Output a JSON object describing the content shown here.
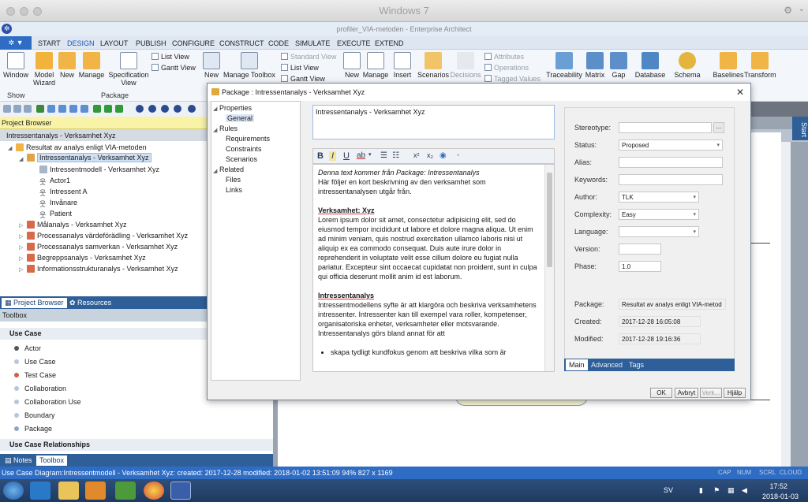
{
  "mac": {
    "title": "Windows 7"
  },
  "ea": {
    "title": "profiler_VIA-metoden - Enterprise Architect"
  },
  "menu": {
    "app_button": "▼",
    "tabs": [
      "START",
      "DESIGN",
      "LAYOUT",
      "PUBLISH",
      "CONFIGURE",
      "CONSTRUCT",
      "CODE",
      "SIMULATE",
      "EXECUTE",
      "EXTEND"
    ],
    "active": "DESIGN"
  },
  "ribbon": {
    "window": "Window",
    "model_wizard": [
      "Model",
      "Wizard"
    ],
    "new": "New",
    "manage": "Manage",
    "spec_view": [
      "Specification",
      "View"
    ],
    "list_view": "List View",
    "gantt_view": "Gantt View",
    "new2": "New",
    "manage_toolbox": "Manage Toolbox",
    "standard_view": "Standard View",
    "list_view2": "List View",
    "gantt_view2": "Gantt View",
    "new3": "New",
    "manage3": "Manage",
    "insert": "Insert",
    "scenarios": "Scenarios",
    "decisions": "Decisions",
    "attributes": "Attributes",
    "operations": "Operations",
    "tagged_values": "Tagged Values",
    "traceability": "Traceability",
    "matrix": "Matrix",
    "gap": "Gap",
    "database": "Database",
    "schema": "Schema",
    "baselines": "Baselines",
    "transform": "Transform",
    "group_show": "Show",
    "group_package": "Package"
  },
  "project_browser": {
    "header": "Project Browser",
    "root": "Intressentanalys - Verksamhet Xyz",
    "items": [
      {
        "label": "Resultat av analys enligt VIA-metoden"
      },
      {
        "label": "Intressentanalys - Verksamhet Xyz"
      },
      {
        "label": "Intressentmodell - Verksamhet Xyz"
      },
      {
        "label": "Actor1"
      },
      {
        "label": "Intressent A"
      },
      {
        "label": "Invånare"
      },
      {
        "label": "Patient"
      },
      {
        "label": "Målanalys - Verksamhet Xyz"
      },
      {
        "label": "Processanalys värdeförädling - Verksamhet Xyz"
      },
      {
        "label": "Processanalys samverkan - Verksamhet Xyz"
      },
      {
        "label": "Begreppsanalys - Verksamhet Xyz"
      },
      {
        "label": "Informationsstrukturanalys - Verksamhet Xyz"
      }
    ],
    "tabs": [
      "Project Browser",
      "Resources"
    ]
  },
  "toolbox": {
    "header": "Toolbox",
    "section1": "Use Case",
    "items": [
      "Actor",
      "Use Case",
      "Test Case",
      "Collaboration",
      "Collaboration Use",
      "Boundary",
      "Package"
    ],
    "section2": "Use Case Relationships",
    "tabs": [
      "Notes",
      "Toolbox"
    ]
  },
  "start_tab": "Start",
  "status": {
    "text": "Use Case Diagram:Intressentmodell - Verksamhet Xyz:  created: 2017-12-28  modified: 2018-01-02 13:51:09   94%   827 x 1169",
    "caps": "CAP",
    "num": "NUM",
    "scrl": "SCRL",
    "cloud": "CLOUD"
  },
  "taskbar": {
    "lang": "SV",
    "time": "17:52",
    "date": "2018-01-03"
  },
  "dialog": {
    "title": "Package : Intressentanalys - Verksamhet Xyz",
    "nav": {
      "properties": "Properties",
      "general": "General",
      "rules": "Rules",
      "requirements": "Requirements",
      "constraints": "Constraints",
      "scenarios": "Scenarios",
      "related": "Related",
      "files": "Files",
      "links": "Links"
    },
    "name": "Intressentanalys - Verksamhet Xyz",
    "editor": {
      "line1": "Denna text kommer från Package: Intressentanalys",
      "line2": "Här följer en kort beskrivning av den verksamhet som intressentanalysen utgår från.",
      "heading1": "Verksamhet: Xyz",
      "para1": "Lorem ipsum dolor sit amet, consectetur adipisicing elit, sed do eiusmod tempor incididunt ut labore et dolore magna aliqua. Ut enim ad minim veniam, quis nostrud exercitation ullamco laboris nisi ut aliquip ex ea commodo consequat. Duis aute irure dolor in reprehenderit in voluptate velit esse cillum dolore eu fugiat nulla pariatur. Excepteur sint occaecat cupidatat non proident, sunt in culpa qui officia deserunt mollit anim id est laborum.",
      "heading2": "Intressentanalys",
      "para2": "Intressentmodellens syfte är att klargöra och beskriva verksamhetens intressenter. Intressenter kan till exempel vara roller, kompetenser, organisatoriska enheter, verksamheter eller motsvarande. Intressentanalys görs bland annat för att",
      "bullet1": "skapa tydligt kundfokus genom att beskriva vilka som är"
    },
    "props": {
      "stereotype_label": "Stereotype:",
      "stereotype": "",
      "stereotype_btn": "...",
      "status_label": "Status:",
      "status": "Proposed",
      "alias_label": "Alias:",
      "alias": "",
      "keywords_label": "Keywords:",
      "keywords": "",
      "author_label": "Author:",
      "author": "TLK",
      "complexity_label": "Complexity:",
      "complexity": "Easy",
      "language_label": "Language:",
      "language": "",
      "version_label": "Version:",
      "version": "",
      "phase_label": "Phase:",
      "phase": "1.0",
      "package_label": "Package:",
      "package": "Resultat av analys enligt VIA-metod",
      "created_label": "Created:",
      "created": "2017-12-28 16:05:08",
      "modified_label": "Modified:",
      "modified": "2017-12-28 19:16:36"
    },
    "prop_tabs": [
      "Main",
      "Advanced",
      "Tags"
    ],
    "buttons": {
      "ok": "OK",
      "cancel": "Avbryt",
      "apply": "Verk...",
      "help": "Hjälp"
    }
  }
}
